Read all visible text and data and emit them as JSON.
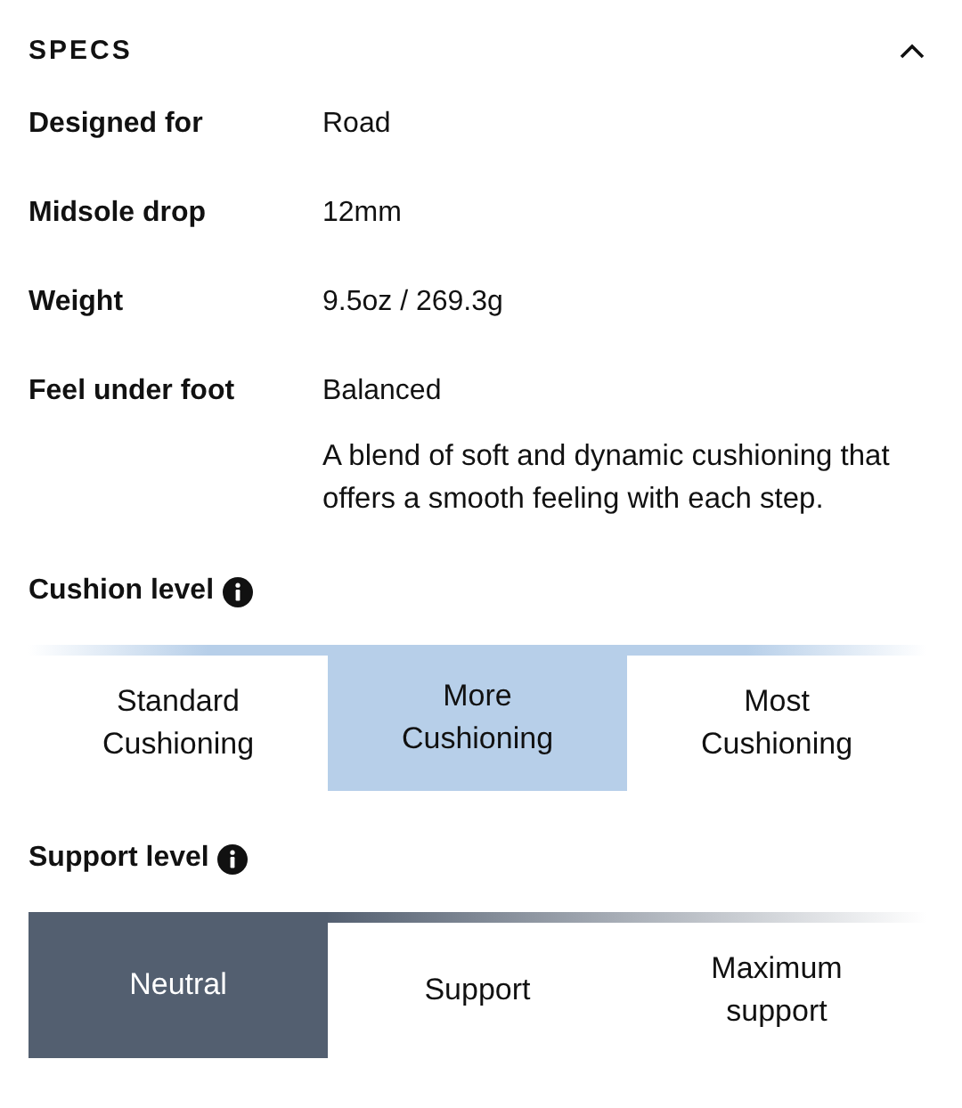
{
  "section": {
    "title": "SPECS",
    "expanded": true
  },
  "specs": [
    {
      "label": "Designed for",
      "value": "Road"
    },
    {
      "label": "Midsole drop",
      "value": "12mm"
    },
    {
      "label": "Weight",
      "value": "9.5oz / 269.3g"
    },
    {
      "label": "Feel under foot",
      "value": "Balanced",
      "description": "A blend of soft and dynamic cushioning that offers a smooth feeling with each step."
    }
  ],
  "levels": [
    {
      "kind": "cushion",
      "title": "Cushion level",
      "options": [
        {
          "label": "Standard Cushioning",
          "selected": false
        },
        {
          "label": "More Cushioning",
          "selected": true
        },
        {
          "label": "Most Cushioning",
          "selected": false
        }
      ]
    },
    {
      "kind": "support",
      "title": "Support level",
      "options": [
        {
          "label": "Neutral",
          "selected": true
        },
        {
          "label": "Support",
          "selected": false
        },
        {
          "label": "Maximum support",
          "selected": false
        }
      ]
    }
  ]
}
